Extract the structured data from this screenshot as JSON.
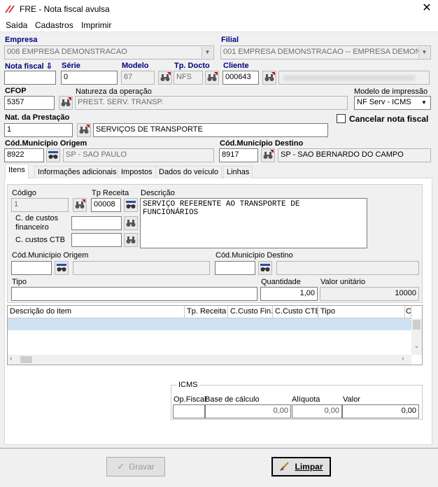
{
  "window": {
    "title": "FRE - Nota fiscal avulsa",
    "close": "✕"
  },
  "menu": [
    "Saída",
    "Cadastros",
    "Imprimir"
  ],
  "labels": {
    "empresa": "Empresa",
    "filial": "Filial",
    "nota_fiscal": "Nota fiscal",
    "serie": "Série",
    "modelo": "Modelo",
    "tp_docto": "Tp. Docto",
    "cliente": "Cliente",
    "cfop": "CFOP",
    "natureza": "Natureza da operação",
    "modelo_impressao": "Modelo de impressão",
    "nat_prestacao": "Nat. da Prestação",
    "cancelar": "Cancelar nota fiscal",
    "mun_origem": "Cód.Município Origem",
    "mun_destino": "Cód.Município Destino"
  },
  "fields": {
    "empresa": "008 EMPRESA DEMONSTRACAO",
    "filial": "001 EMPRESA DEMONSTRACAO -- EMPRESA DEMONS",
    "nota_fiscal": "",
    "serie": "0",
    "modelo": "67",
    "tp_docto": "NFS",
    "cliente_code": "000643",
    "cliente_name": "",
    "cfop": "5357",
    "natureza": "PREST. SERV. TRANSP.",
    "modelo_impressao": "NF Serv - ICMS",
    "nat_prestacao_code": "1",
    "nat_prestacao_desc": "SERVIÇOS DE TRANSPORTE",
    "mun_origem_code": "8922",
    "mun_origem_name": "SP - SAO PAULO",
    "mun_destino_code": "8917",
    "mun_destino_name": "SP - SAO BERNARDO DO CAMPO"
  },
  "tabs": [
    "Itens",
    "Informações adicionais",
    "Impostos",
    "Dados do veículo",
    "Linhas"
  ],
  "itens": {
    "labels": {
      "codigo": "Código",
      "tp_receita": "Tp Receita",
      "descricao": "Descrição",
      "custos_fin": "C. de custos financeiro",
      "custos_ctb": "C. custos CTB",
      "mun_origem": "Cód.Município Origem",
      "mun_destino": "Cód.Município Destino",
      "tipo": "Tipo",
      "quantidade": "Quantidade",
      "valor_unitario": "Valor unitário"
    },
    "values": {
      "codigo": "1",
      "tp_receita": "00008",
      "descricao": "SERVIÇO REFERENTE AO TRANSPORTE DE FUNCIONÁRIOS",
      "custos_fin": "",
      "custos_ctb": "",
      "mun_origem": "",
      "mun_origem_name": "",
      "mun_destino": "",
      "mun_destino_name": "",
      "tipo": "",
      "quantidade": "1,00",
      "valor_unitario": "10000"
    },
    "grid_columns": [
      "Descrição do item",
      "Tp. Receita",
      "C.Custo Fin.",
      "C.Custo CTB",
      "Tipo",
      "C"
    ]
  },
  "icms": {
    "title": "ICMS",
    "labels": {
      "op_fiscal": "Op.Fiscal",
      "base": "Base de cálculo",
      "aliquota": "Alíquota",
      "valor": "Valor"
    },
    "values": {
      "op_fiscal": "",
      "base": "0,00",
      "aliquota": "0,00",
      "valor": "0,00"
    }
  },
  "buttons": {
    "gravar": "Gravar",
    "limpar": "Limpar"
  }
}
